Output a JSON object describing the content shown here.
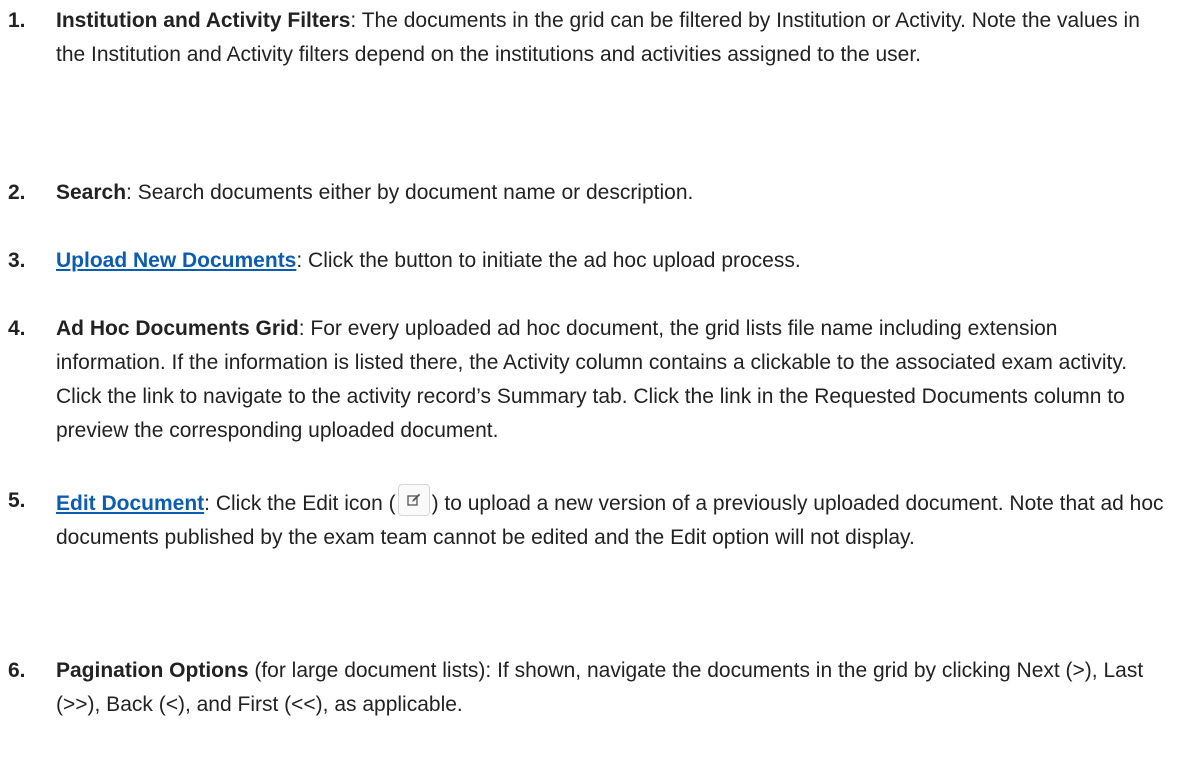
{
  "items": [
    {
      "number": "1.",
      "title": "Institution and Activity Filters",
      "text": ": The documents in the grid can be filtered by Institution or Activity.  Note the values in the Institution and Activity filters depend on the institutions and activities assigned to the user."
    },
    {
      "number": "2.",
      "title": "Search",
      "text": ": Search documents either by document name or description."
    },
    {
      "number": "3.",
      "title": "Upload New Documents",
      "text": ": Click the button to initiate the ad hoc upload process."
    },
    {
      "number": "4.",
      "title": "Ad Hoc Documents Grid",
      "text": ": For every uploaded ad hoc document, the grid lists file name including extension information.  If the information is listed there, the Activity column contains a clickable to the associated exam activity.  Click the link to navigate to the activity record’s Summary tab.  Click the link in the Requested Documents column to preview the corresponding uploaded document."
    },
    {
      "number": "5.",
      "title": "Edit Document",
      "text_before": ":  Click the Edit icon (",
      "text_after": ") to upload a new version of a previously uploaded document.  Note that ad hoc documents published by the exam team cannot be edited and the Edit option will not display."
    },
    {
      "number": "6.",
      "title": "Pagination Options",
      "text": " (for large document lists):  If shown, navigate the documents in the grid by clicking Next (>), Last (>>), Back (<), and First (<<), as applicable."
    }
  ],
  "colors": {
    "link": "#0b5db3",
    "text": "#222222"
  },
  "icons": {
    "edit": "edit-pencil-icon"
  }
}
